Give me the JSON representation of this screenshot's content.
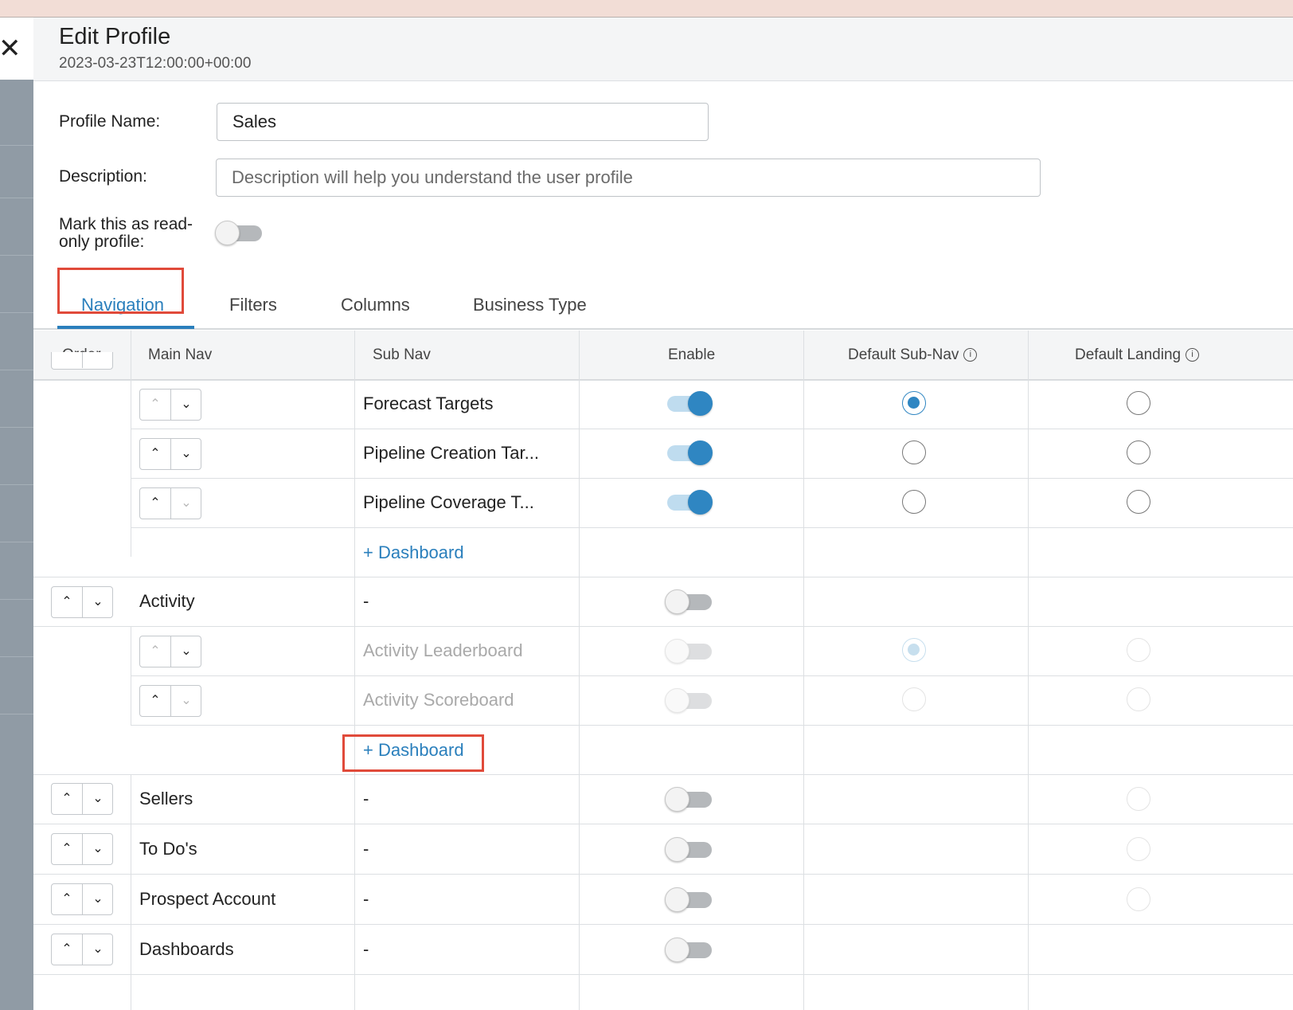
{
  "header": {
    "title": "Edit Profile",
    "timestamp": "2023-03-23T12:00:00+00:00"
  },
  "form": {
    "profile_name_label": "Profile Name:",
    "profile_name_value": "Sales",
    "description_label": "Description:",
    "description_placeholder": "Description will help you understand the user profile",
    "readonly_label": "Mark this as read-only profile:",
    "readonly_enabled": false
  },
  "tabs": [
    "Navigation",
    "Filters",
    "Columns",
    "Business Type"
  ],
  "active_tab": "Navigation",
  "table": {
    "columns": [
      "Order",
      "Main Nav",
      "Sub Nav",
      "Enable",
      "Default Sub-Nav",
      "Default Landing"
    ],
    "info_icon": "info-icon",
    "rows": [
      {
        "type": "sub",
        "sub": "Forecast Targets",
        "enabled": true,
        "default_sub": true,
        "default_landing": false
      },
      {
        "type": "sub",
        "sub": "Pipeline Creation Tar...",
        "enabled": true,
        "default_sub": false,
        "default_landing": false
      },
      {
        "type": "sub",
        "sub": "Pipeline Coverage T...",
        "enabled": true,
        "default_sub": false,
        "default_landing": false
      },
      {
        "type": "add",
        "label": "+ Dashboard"
      },
      {
        "type": "main",
        "main": "Activity",
        "sub": "-",
        "enabled": false
      },
      {
        "type": "sub",
        "sub": "Activity Leaderboard",
        "enabled": false,
        "default_sub": true,
        "default_landing": false,
        "disabled": true
      },
      {
        "type": "sub",
        "sub": "Activity Scoreboard",
        "enabled": false,
        "default_sub": false,
        "default_landing": false,
        "disabled": true
      },
      {
        "type": "add",
        "label": "+ Dashboard"
      },
      {
        "type": "main",
        "main": "Sellers",
        "sub": "-",
        "enabled": false
      },
      {
        "type": "main",
        "main": "To Do's",
        "sub": "-",
        "enabled": false
      },
      {
        "type": "main",
        "main": "Prospect Account",
        "sub": "-",
        "enabled": false
      },
      {
        "type": "main",
        "main": "Dashboards",
        "sub": "-",
        "enabled": false
      }
    ]
  },
  "colors": {
    "accent": "#2a7fbc",
    "highlight_box": "#e04a3a"
  }
}
